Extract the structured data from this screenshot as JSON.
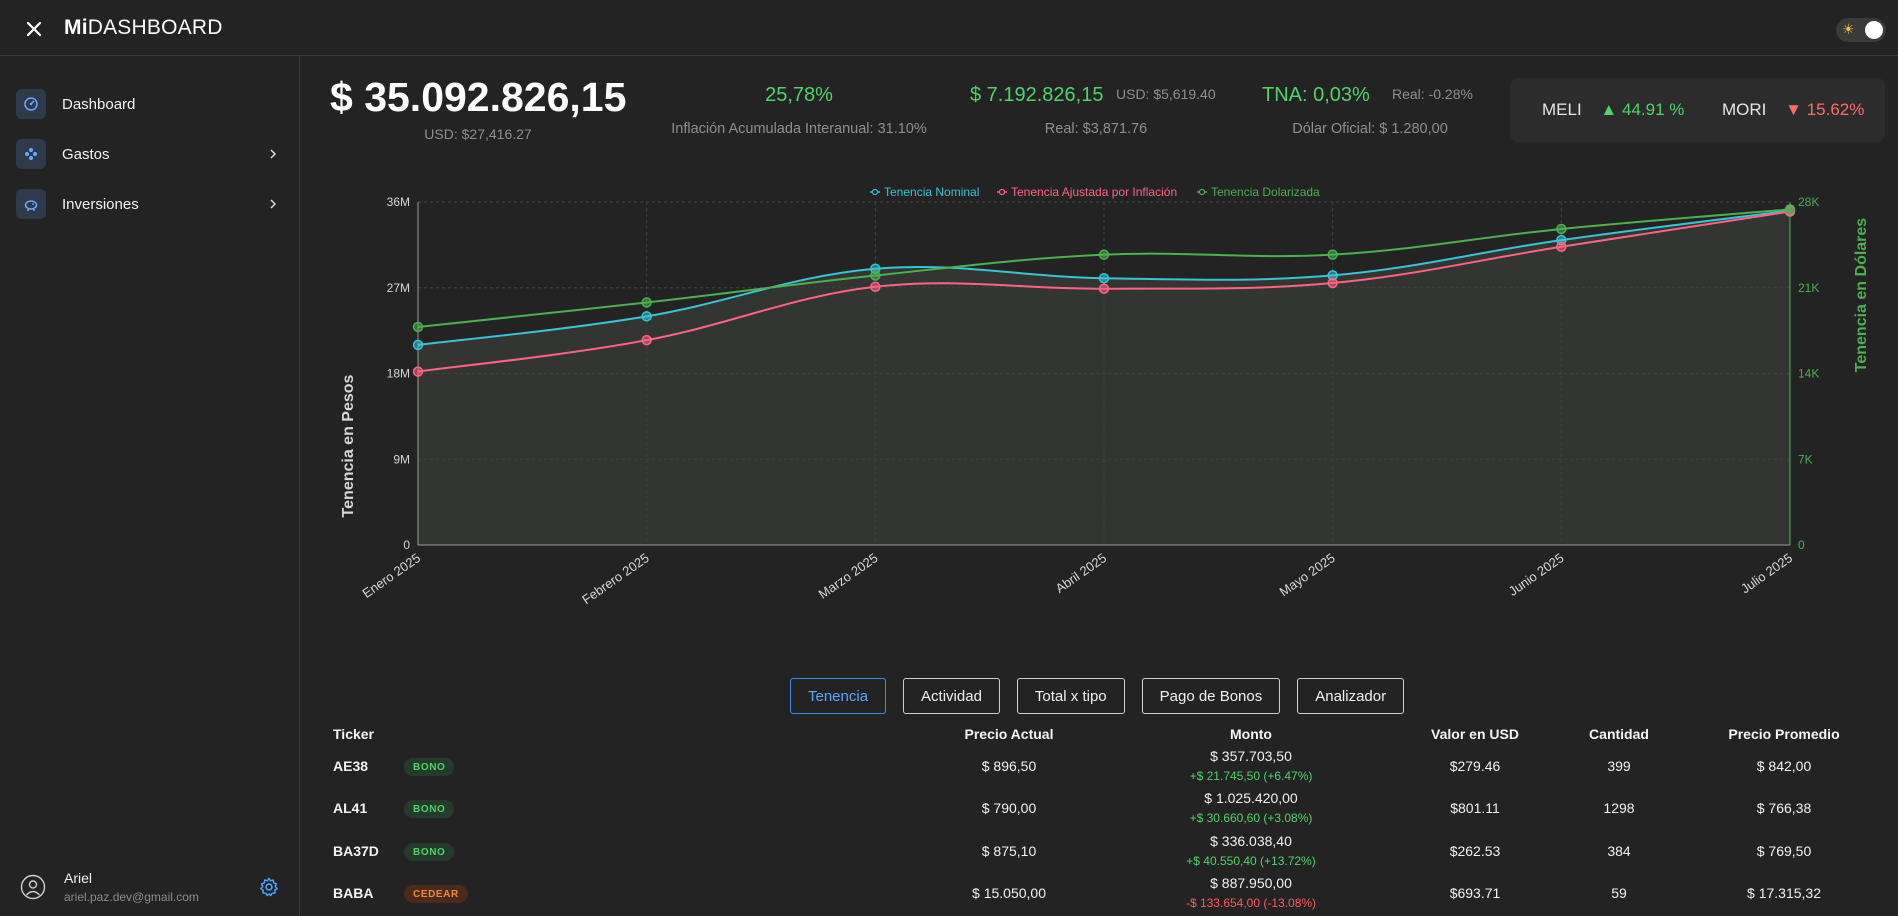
{
  "app": {
    "brand_bold": "Mi",
    "brand_rest": "DASHBOARD"
  },
  "sidebar": {
    "items": [
      {
        "label": "Dashboard",
        "icon": "gauge-icon",
        "has_chevron": false
      },
      {
        "label": "Gastos",
        "icon": "money-icon",
        "has_chevron": true
      },
      {
        "label": "Inversiones",
        "icon": "piggy-bank-icon",
        "has_chevron": true
      }
    ],
    "user": {
      "name": "Ariel",
      "email": "ariel.paz.dev@gmail.com"
    }
  },
  "summary": {
    "total": "$ 35.092.826,15",
    "total_usd": "USD: $27,416.27",
    "inflation_pct": "25,78%",
    "inflation_label": "Inflación Acumulada Interanual: 31.10%",
    "gain": "$ 7.192.826,15",
    "gain_usd": "USD: $5,619.40",
    "gain_real": "Real: $3,871.76",
    "tna": "TNA: 0,03%",
    "tna_real": "Real: -0.28%",
    "dolar": "Dólar Oficial: $ 1.280,00"
  },
  "tickers": [
    {
      "name": "MELI",
      "arrow": "▲",
      "change": "44.91 %",
      "color": "#4fd36a"
    },
    {
      "name": "MORI",
      "arrow": "▼",
      "change": "15.62%",
      "color": "#ff6b6b"
    }
  ],
  "chart_data": {
    "type": "line",
    "categories": [
      "Enero 2025",
      "Febrero 2025",
      "Marzo 2025",
      "Abril 2025",
      "Mayo 2025",
      "Junio 2025",
      "Julio 2025"
    ],
    "series": [
      {
        "name": "Tenencia Nominal",
        "axis": "left",
        "color": "#39c3d6",
        "values": [
          21000000,
          24000000,
          29000000,
          28000000,
          28300000,
          32000000,
          35100000
        ]
      },
      {
        "name": "Tenencia Ajustada por Inflación",
        "axis": "left",
        "color": "#ff6384",
        "values": [
          18200000,
          21500000,
          27100000,
          26900000,
          27500000,
          31300000,
          35000000
        ]
      },
      {
        "name": "Tenencia Dolarizada",
        "axis": "right",
        "color": "#4caf50",
        "values": [
          17800000,
          19800000,
          22000000,
          23700000,
          23700000,
          25800000,
          27400000
        ]
      }
    ],
    "ylabel": "Tenencia en Pesos",
    "y2label": "Tenencia en Dólares",
    "ylim": [
      0,
      36000000
    ],
    "y2lim": [
      0,
      28000
    ],
    "yticks": [
      "0",
      "9M",
      "18M",
      "27M",
      "36M"
    ],
    "y2ticks": [
      "0",
      "7K",
      "14K",
      "21K",
      "28K"
    ],
    "grid": true,
    "legend": "top"
  },
  "tabs": [
    "Tenencia",
    "Actividad",
    "Total x tipo",
    "Pago de Bonos",
    "Analizador"
  ],
  "table": {
    "headers": [
      "Ticker",
      "Precio Actual",
      "Monto",
      "Valor en USD",
      "Cantidad",
      "Precio Promedio"
    ],
    "rows": [
      {
        "ticker": "AE38",
        "type": "BONO",
        "precio": "$ 896,50",
        "monto": "$ 357.703,50",
        "delta": "+$ 21.745,50  (+6.47%)",
        "up": true,
        "usd": "$279.46",
        "cantidad": "399",
        "promedio": "$ 842,00"
      },
      {
        "ticker": "AL41",
        "type": "BONO",
        "precio": "$ 790,00",
        "monto": "$ 1.025.420,00",
        "delta": "+$ 30.660,60  (+3.08%)",
        "up": true,
        "usd": "$801.11",
        "cantidad": "1298",
        "promedio": "$ 766,38"
      },
      {
        "ticker": "BA37D",
        "type": "BONO",
        "precio": "$ 875,10",
        "monto": "$ 336.038,40",
        "delta": "+$ 40.550,40  (+13.72%)",
        "up": true,
        "usd": "$262.53",
        "cantidad": "384",
        "promedio": "$ 769,50"
      },
      {
        "ticker": "BABA",
        "type": "CEDEAR",
        "precio": "$ 15.050,00",
        "monto": "$ 887.950,00",
        "delta": "-$ 133.654,00  (-13.08%)",
        "up": false,
        "usd": "$693.71",
        "cantidad": "59",
        "promedio": "$ 17.315,32"
      }
    ]
  }
}
